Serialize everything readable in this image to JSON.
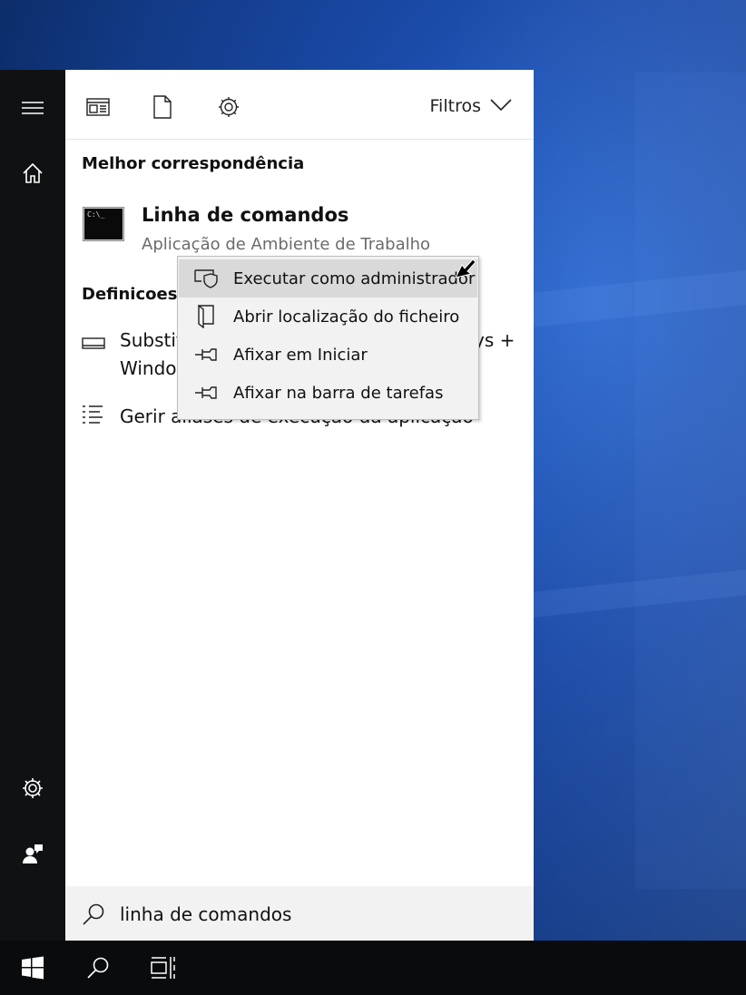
{
  "top_filters": {
    "filters_label": "Filtros"
  },
  "best_match": {
    "section_title": "Melhor correspondência",
    "app_name": "Linha de comandos",
    "app_type": "Aplicação de Ambiente de Trabalho",
    "icon_text": "C:\\_"
  },
  "settings_section": {
    "title": "Definicoes",
    "items": [
      {
        "label_line1": "Substit",
        "label_line1_end": "ys +",
        "label_line2": "Windo"
      },
      {
        "label": "Gerir aliases de execução da aplicação"
      }
    ]
  },
  "context_menu": {
    "items": [
      {
        "label": "Executar como administrador",
        "icon": "shield-run-icon",
        "highlighted": true
      },
      {
        "label": "Abrir localização do ficheiro",
        "icon": "open-folder-icon",
        "highlighted": false
      },
      {
        "label": "Afixar em Iniciar",
        "icon": "pin-icon",
        "highlighted": false
      },
      {
        "label": "Afixar na barra de tarefas",
        "icon": "pin-icon",
        "highlighted": false
      }
    ]
  },
  "search": {
    "value": "linha de comandos"
  },
  "colors": {
    "rail_bg": "#0f1113",
    "panel_bg": "#ffffff",
    "menu_bg": "#f2f2f2",
    "menu_highlight": "#d9d9d9",
    "taskbar_bg": "#0a0b0d"
  }
}
